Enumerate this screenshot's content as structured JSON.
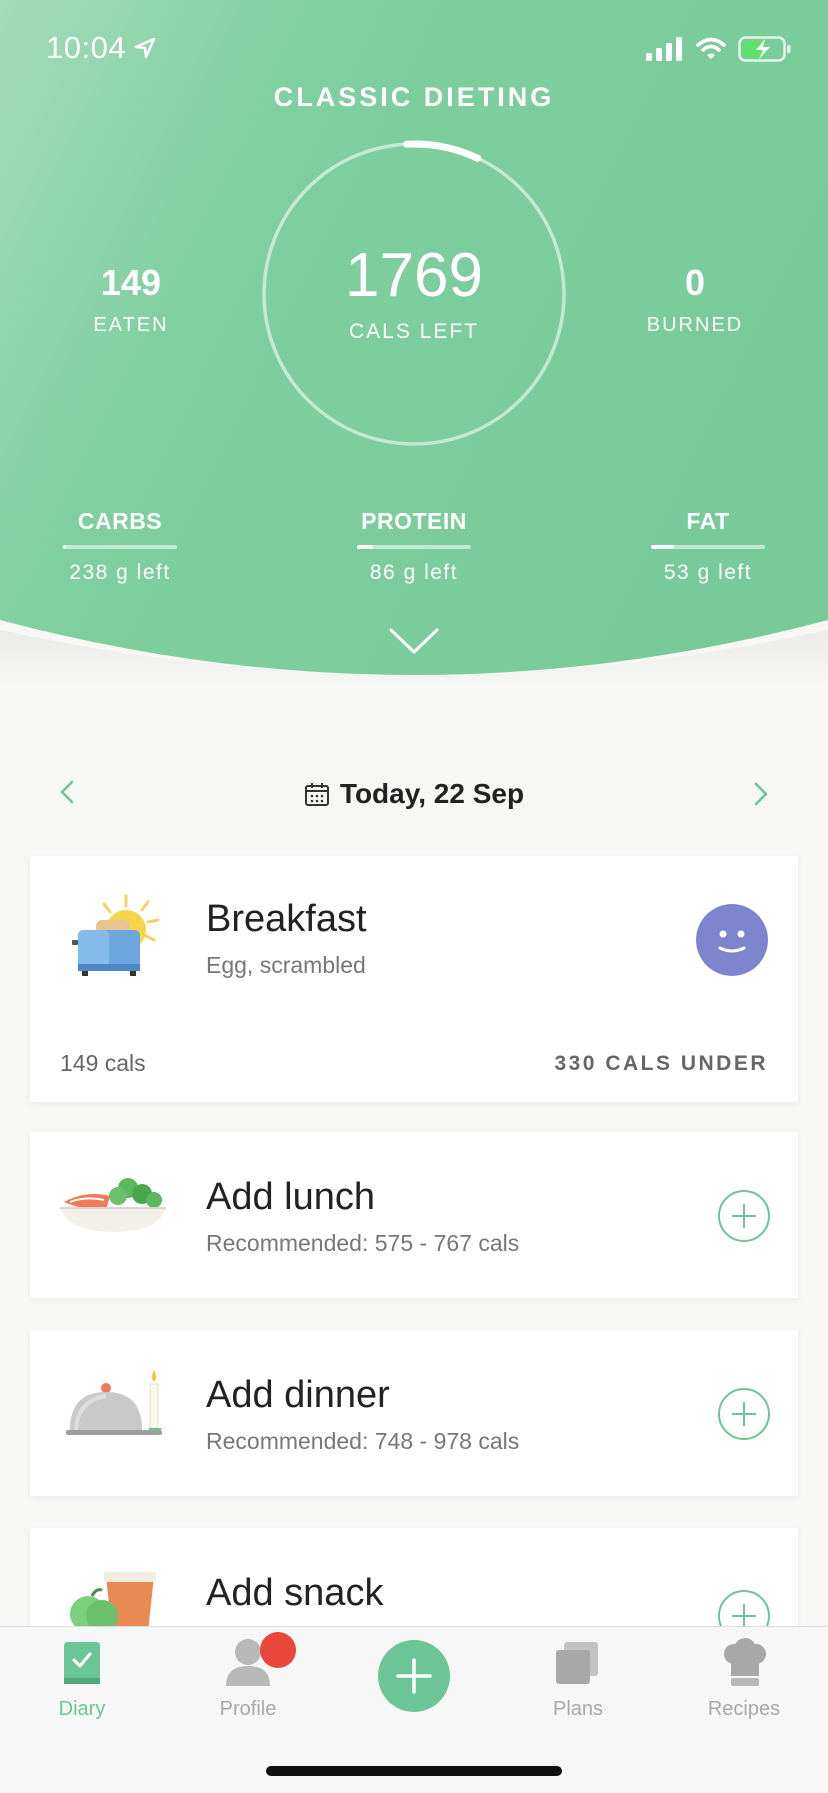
{
  "status": {
    "time": "10:04"
  },
  "header": {
    "title": "CLASSIC DIETING",
    "cals_left": "1769",
    "cals_left_label": "CALS LEFT",
    "eaten": "149",
    "eaten_label": "EATEN",
    "burned": "0",
    "burned_label": "BURNED",
    "ring_progress": 0.078
  },
  "macros": [
    {
      "name": "CARBS",
      "left": "238 g left",
      "progress": 0.03
    },
    {
      "name": "PROTEIN",
      "left": "86 g left",
      "progress": 0.14
    },
    {
      "name": "FAT",
      "left": "53 g left",
      "progress": 0.2
    }
  ],
  "date": {
    "label": "Today, 22 Sep"
  },
  "meals": {
    "breakfast": {
      "title": "Breakfast",
      "sub": "Egg, scrambled",
      "cals": "149 cals",
      "status": "330 CALS UNDER"
    },
    "lunch": {
      "title": "Add lunch",
      "sub": "Recommended: 575 - 767  cals"
    },
    "dinner": {
      "title": "Add dinner",
      "sub": "Recommended: 748 - 978  cals"
    },
    "snack": {
      "title": "Add snack"
    }
  },
  "tabs": {
    "diary": "Diary",
    "profile": "Profile",
    "plans": "Plans",
    "recipes": "Recipes"
  },
  "colors": {
    "accent": "#6cc594",
    "header_green": "#7dcf9c",
    "avatar": "#7d86cc",
    "badge": "#e8473a"
  }
}
